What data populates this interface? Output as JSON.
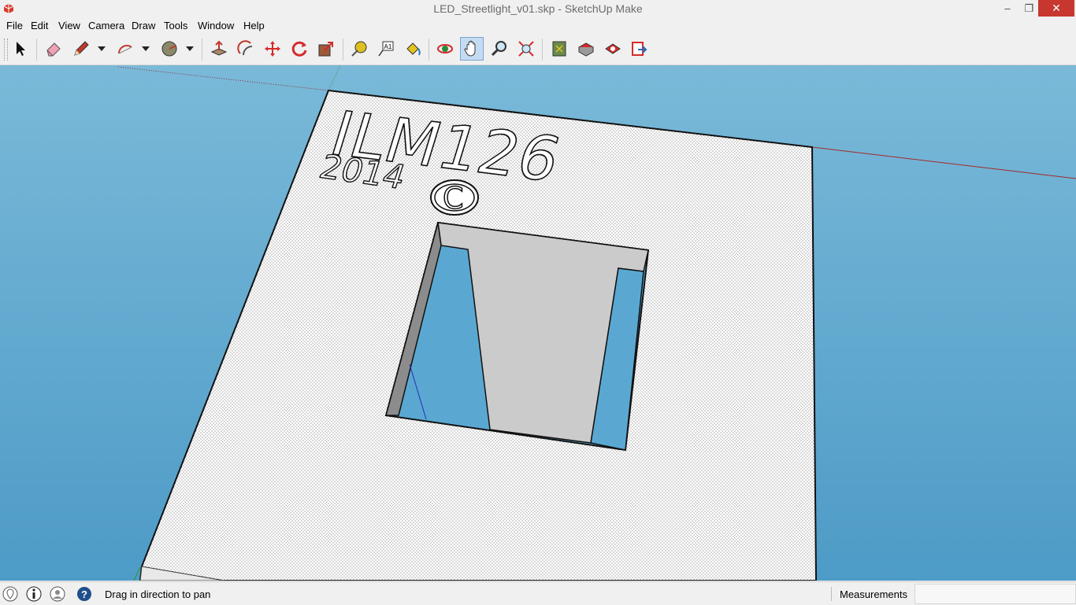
{
  "window": {
    "title": "LED_Streetlight_v01.skp - SketchUp Make",
    "minimize": "–",
    "maximize": "❐",
    "close": "✕"
  },
  "menu": [
    "File",
    "Edit",
    "View",
    "Camera",
    "Draw",
    "Tools",
    "Window",
    "Help"
  ],
  "toolbar": {
    "tools": [
      {
        "name": "select-tool",
        "icon": "arrow-cursor-icon"
      },
      {
        "name": "eraser-tool",
        "icon": "eraser-icon"
      },
      {
        "name": "line-tool",
        "icon": "pencil-icon"
      },
      {
        "name": "arc-tool",
        "icon": "arc-icon"
      },
      {
        "name": "circle-tool",
        "icon": "circle-icon"
      },
      {
        "name": "push-pull-tool",
        "icon": "push-pull-icon"
      },
      {
        "name": "offset-tool",
        "icon": "offset-icon"
      },
      {
        "name": "move-tool",
        "icon": "move-arrows-icon"
      },
      {
        "name": "rotate-tool",
        "icon": "rotate-icon"
      },
      {
        "name": "scale-tool",
        "icon": "scale-icon"
      },
      {
        "name": "tape-measure-tool",
        "icon": "tape-measure-icon"
      },
      {
        "name": "text-tool",
        "icon": "text-a1-icon"
      },
      {
        "name": "paint-bucket-tool",
        "icon": "paint-bucket-icon"
      },
      {
        "name": "orbit-tool",
        "icon": "orbit-icon"
      },
      {
        "name": "pan-tool",
        "icon": "hand-pan-icon",
        "active": true
      },
      {
        "name": "zoom-tool",
        "icon": "magnifier-icon"
      },
      {
        "name": "zoom-extents-tool",
        "icon": "zoom-extents-icon"
      },
      {
        "name": "warehouse-tool",
        "icon": "map-book-icon"
      },
      {
        "name": "get-models-tool",
        "icon": "warehouse-box-icon"
      },
      {
        "name": "share-model-tool",
        "icon": "share-model-icon"
      },
      {
        "name": "extension-warehouse-tool",
        "icon": "export-arrow-icon"
      }
    ]
  },
  "colors": {
    "sky": "#5fa7ce",
    "face": "#ffffff",
    "hole_wall": "#c9c9c9",
    "shadow_wall": "#8a8a8a",
    "red_axis": "#a22a2a",
    "green_axis": "#2a9b2a",
    "blue_axis": "#2a2ab0"
  },
  "model": {
    "embossed_text_line1": "ILM126",
    "embossed_text_line2": "2014",
    "copyright_symbol": "C"
  },
  "status": {
    "hint": "Drag in direction to pan",
    "measurements_label": "Measurements",
    "measurements_value": ""
  }
}
